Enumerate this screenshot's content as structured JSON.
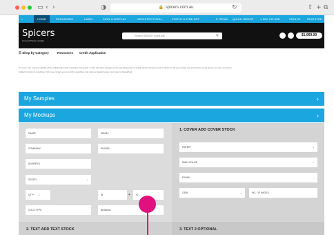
{
  "browser": {
    "url": "spicers.com.au",
    "lock": "🔒"
  },
  "topnav": {
    "items": [
      "HOME",
      "PACKAGING",
      "LABEL",
      "SIGN & DISPLAY",
      "ARCHITECTURAL",
      "PHOTO & FINE ART"
    ],
    "right": [
      "♥ ITEMS",
      "QUICK ORDER",
      "1 800 733 888",
      "SIGN IN",
      "REGISTER"
    ]
  },
  "header": {
    "logo": "Spicers",
    "logo_sub": "Connect Partner Quality",
    "search_placeholder": "Search 50000+ products",
    "cart": "$1,069.00"
  },
  "subnav": {
    "items": [
      "☰  Shop by Category",
      "Resources",
      "Credit Application"
    ]
  },
  "intro": {
    "lines": [
      "To ensure the ongoing viability of the collaboration that underpins being able to offer this wide-ranging service providing custom quality printed samples and mockups for all your design and production needs please see the note below.",
      "Subject to terms & conditions. We may contact you to confirm quantities and delivery details before your order is dispatched."
    ]
  },
  "accordion": {
    "samples": "My Samples",
    "mockups": "My Mockups",
    "chevron": "›"
  },
  "form": {
    "name": "NAME*",
    "email": "EMAIL*",
    "company": "COMPANY*",
    "phone": "PHONE*",
    "address": "ADDRESS",
    "state": "STATE*",
    "qty_label": "QTY*",
    "qty_value": "1",
    "width": "W",
    "height": "H",
    "cols_type": "COLS TYPE",
    "binding": "BINDING",
    "plus": "+"
  },
  "right_form": {
    "title": "1. COVER ADD COVER STOCK",
    "paper": "PAPER*",
    "main_color": "MAIN COLOR",
    "finish": "FINISH",
    "gsm": "GSM",
    "pages": "NO. OF PAGES",
    "caret": "⌄"
  },
  "footer": {
    "left": "2. TEXT ADD TEXT STOCK",
    "right": "3. TEXT 2 OPTIONAL"
  },
  "colors": {
    "accent": "#1ba6e0",
    "dark": "#111111",
    "cursor": "#e0117f"
  }
}
